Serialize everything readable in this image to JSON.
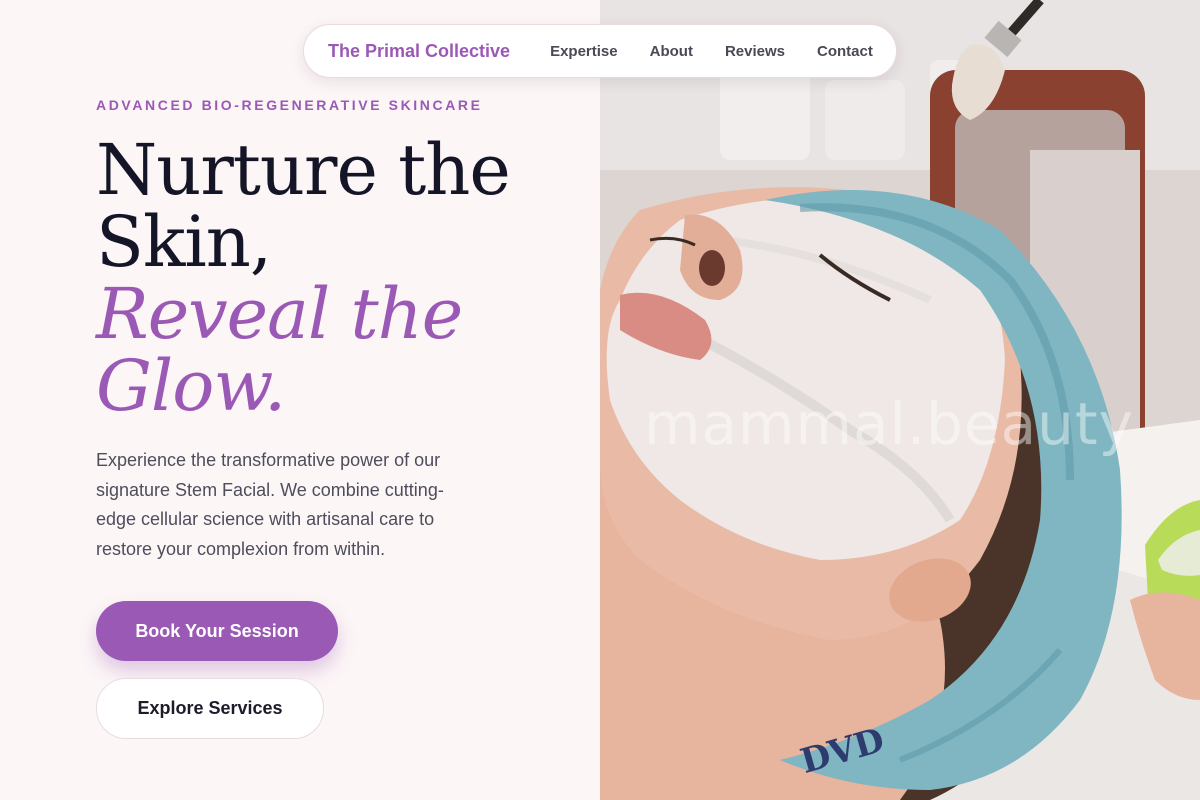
{
  "nav": {
    "brand": "The Primal Collective",
    "links": [
      "Expertise",
      "About",
      "Reviews",
      "Contact"
    ]
  },
  "hero": {
    "eyebrow": "ADVANCED BIO-REGENERATIVE SKINCARE",
    "headline_line1": "Nurture the",
    "headline_line2": "Skin,",
    "headline_accent_line1": "Reveal the",
    "headline_accent_line2": "Glow.",
    "description": "Experience the transformative power of our signature Stem Facial. We combine cutting-edge cellular science with artisanal care to restore your complexion from within.",
    "primary_cta": "Book Your Session",
    "secondary_cta": "Explore Services"
  },
  "image": {
    "watermark": "mammal.beauty",
    "headband_text": "DVD"
  },
  "colors": {
    "accent": "#9b59b6",
    "background": "#fcf6f6",
    "heading": "#151528",
    "body_text": "#4d4d5c",
    "headband": "#7fb6c2"
  }
}
